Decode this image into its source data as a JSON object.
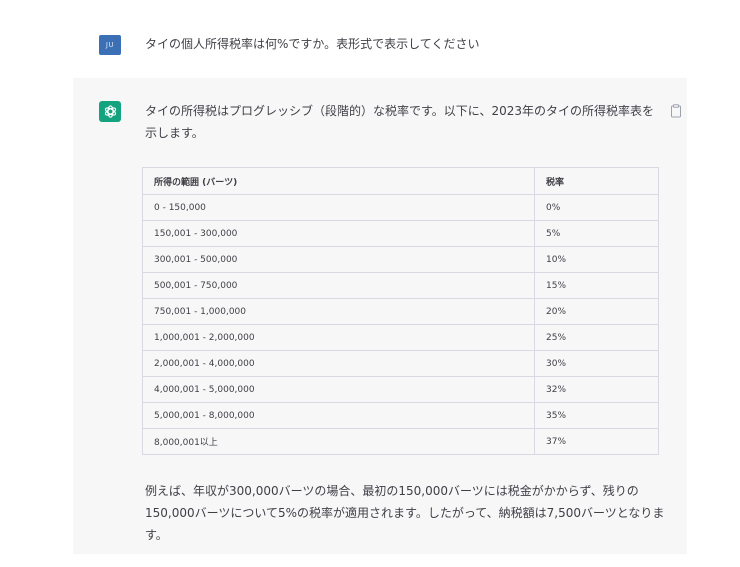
{
  "user": {
    "avatar_text": "JU",
    "message": "タイの個人所得税率は何%ですか。表形式で表示してください"
  },
  "assistant": {
    "intro": "タイの所得税はプログレッシブ（段階的）な税率です。以下に、2023年のタイの所得税率表を示します。",
    "table": {
      "headers": [
        "所得の範囲 (バーツ)",
        "税率"
      ],
      "rows": [
        [
          "0 - 150,000",
          "0%"
        ],
        [
          "150,001 - 300,000",
          "5%"
        ],
        [
          "300,001 - 500,000",
          "10%"
        ],
        [
          "500,001 - 750,000",
          "15%"
        ],
        [
          "750,001 - 1,000,000",
          "20%"
        ],
        [
          "1,000,001 - 2,000,000",
          "25%"
        ],
        [
          "2,000,001 - 4,000,000",
          "30%"
        ],
        [
          "4,000,001 - 5,000,000",
          "32%"
        ],
        [
          "5,000,001 - 8,000,000",
          "35%"
        ],
        [
          "8,000,001以上",
          "37%"
        ]
      ]
    },
    "outro": "例えば、年収が300,000バーツの場合、最初の150,000バーツには税金がかからず、残りの150,000バーツについて5%の税率が適用されます。したがって、納税額は7,500バーツとなります。"
  },
  "icons": {
    "ai_avatar": "openai-logo-icon",
    "copy": "clipboard-icon"
  },
  "colors": {
    "user_avatar": "#3b6fb6",
    "ai_avatar": "#13a37f",
    "assistant_background": "#f7f7f8"
  }
}
